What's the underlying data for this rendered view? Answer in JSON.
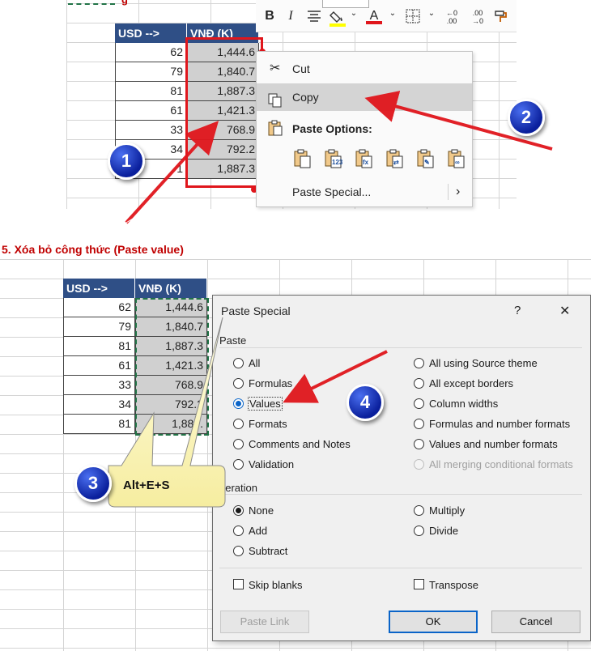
{
  "top_sheet": {
    "header": [
      "USD -->",
      "VNĐ (K)"
    ],
    "usd": [
      "62",
      "79",
      "81",
      "61",
      "33",
      "34",
      "1"
    ],
    "vnd": [
      "1,444.6",
      "1,840.7",
      "1,887.3",
      "1,421.3",
      "768.9",
      "792.2",
      "1,887.3"
    ]
  },
  "context_menu": {
    "cut": "Cut",
    "copy": "Copy",
    "paste_options": "Paste Options:",
    "paste_special": "Paste Special...",
    "paste_icons": [
      "paste-icon",
      "paste-values-icon",
      "paste-formulas-icon",
      "paste-transpose-icon",
      "paste-formatting-icon",
      "paste-link-icon"
    ]
  },
  "mini_toolbar": {
    "bold": "B",
    "italic": "I",
    "font_color": "A",
    "increase_decimal": "←.0 .00",
    "decrease_decimal": ".00 →.0"
  },
  "section_title": "5. Xóa bỏ công thức (Paste value)",
  "bottom_sheet": {
    "header": [
      "USD -->",
      "VNĐ (K)"
    ],
    "usd": [
      "62",
      "79",
      "81",
      "61",
      "33",
      "34",
      "81"
    ],
    "vnd": [
      "1,444.6",
      "1,840.7",
      "1,887.3",
      "1,421.3",
      "768.9",
      "792.2",
      "1,887."
    ]
  },
  "dialog": {
    "title": "Paste Special",
    "help": "?",
    "close": "✕",
    "paste_group": "Paste",
    "paste_left": [
      "All",
      "Formulas",
      "Values",
      "Formats",
      "Comments and Notes",
      "Validation"
    ],
    "paste_right": [
      "All using Source theme",
      "All except borders",
      "Column widths",
      "Formulas and number formats",
      "Values and number formats",
      "All merging conditional formats"
    ],
    "operation_group": "peration",
    "op_left": [
      "None",
      "Add",
      "Subtract"
    ],
    "op_right": [
      "Multiply",
      "Divide"
    ],
    "skip_blanks": "Skip blanks",
    "transpose": "Transpose",
    "paste_link": "Paste Link",
    "ok": "OK",
    "cancel": "Cancel"
  },
  "callouts": {
    "badge1": "1",
    "badge2": "2",
    "badge3": "3",
    "badge4": "4",
    "shortcut": "Alt+E+S"
  },
  "colors": {
    "header_bg": "#2f4f86",
    "arrow_red": "#e0161c",
    "badge_blue": "#0a1f9c",
    "title_red": "#c00000",
    "marching_green": "#217346"
  }
}
